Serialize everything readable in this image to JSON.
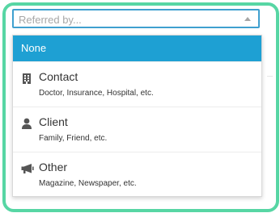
{
  "referral_select": {
    "placeholder": "Referred by...",
    "value": "",
    "caret_icon": "triangle-up-icon"
  },
  "dropdown": {
    "options": [
      {
        "label": "None",
        "highlighted": true
      },
      {
        "label": "Contact",
        "description": "Doctor, Insurance, Hospital, etc.",
        "icon": "building-icon"
      },
      {
        "label": "Client",
        "description": "Family, Friend, etc.",
        "icon": "person-icon"
      },
      {
        "label": "Other",
        "description": "Magazine, Newspaper, etc.",
        "icon": "megaphone-icon"
      }
    ]
  },
  "colors": {
    "frame_border": "#57d6a4",
    "select_border": "#3fa0cf",
    "highlight": "#1ea0d3",
    "icon": "#555555"
  }
}
